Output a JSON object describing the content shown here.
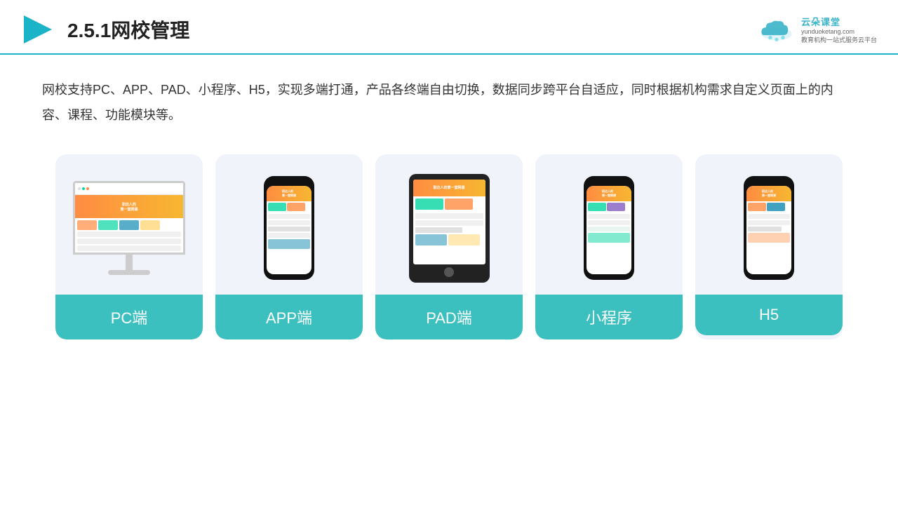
{
  "header": {
    "title": "2.5.1网校管理",
    "logo": {
      "name": "云朵课堂",
      "url": "yunduoketang.com",
      "tagline": "教育机构一站\n式服务云平台"
    }
  },
  "description": "网校支持PC、APP、PAD、小程序、H5，实现多端打通，产品各终端自由切换，数据同步跨平台自适应，同时根据机构需求自定义页面上的内容、课程、功能模块等。",
  "cards": [
    {
      "id": "pc",
      "label": "PC端",
      "device": "monitor"
    },
    {
      "id": "app",
      "label": "APP端",
      "device": "phone"
    },
    {
      "id": "pad",
      "label": "PAD端",
      "device": "tablet"
    },
    {
      "id": "miniprogram",
      "label": "小程序",
      "device": "phone"
    },
    {
      "id": "h5",
      "label": "H5",
      "device": "phone"
    }
  ]
}
